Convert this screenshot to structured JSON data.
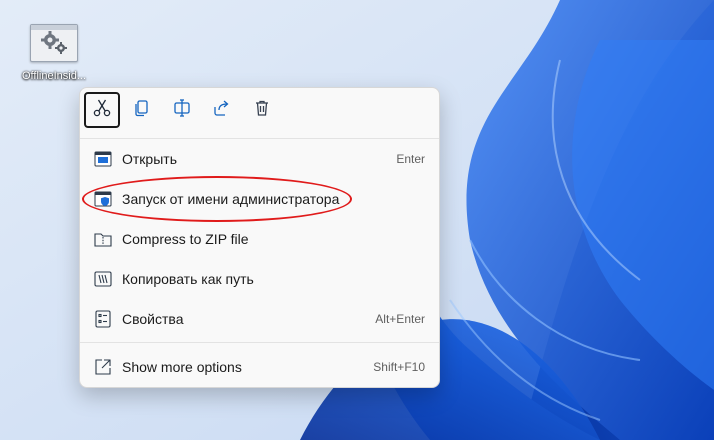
{
  "desktop": {
    "icon_label": "OfflineInsid...",
    "icon_name": "settings-app-icon"
  },
  "context_menu": {
    "toolbar": [
      {
        "name": "cut-icon",
        "label": "Cut"
      },
      {
        "name": "copy-icon",
        "label": "Copy"
      },
      {
        "name": "rename-icon",
        "label": "Rename"
      },
      {
        "name": "share-icon",
        "label": "Share"
      },
      {
        "name": "delete-icon",
        "label": "Delete"
      }
    ],
    "items": [
      {
        "label": "Открыть",
        "accelerator": "Enter",
        "icon": "open-window-icon"
      },
      {
        "label": "Запуск от имени администратора",
        "accelerator": "",
        "icon": "admin-shield-icon"
      },
      {
        "label": "Compress to ZIP file",
        "accelerator": "",
        "icon": "zip-folder-icon"
      },
      {
        "label": "Копировать как путь",
        "accelerator": "",
        "icon": "copy-path-icon"
      },
      {
        "label": "Свойства",
        "accelerator": "Alt+Enter",
        "icon": "properties-icon"
      }
    ],
    "more": {
      "label": "Show more options",
      "accelerator": "Shift+F10",
      "icon": "more-options-icon"
    }
  },
  "colors": {
    "highlight_ring": "#e01b1b",
    "wallpaper_blue": "#0a57e0",
    "menu_bg": "#f9f9f9"
  }
}
